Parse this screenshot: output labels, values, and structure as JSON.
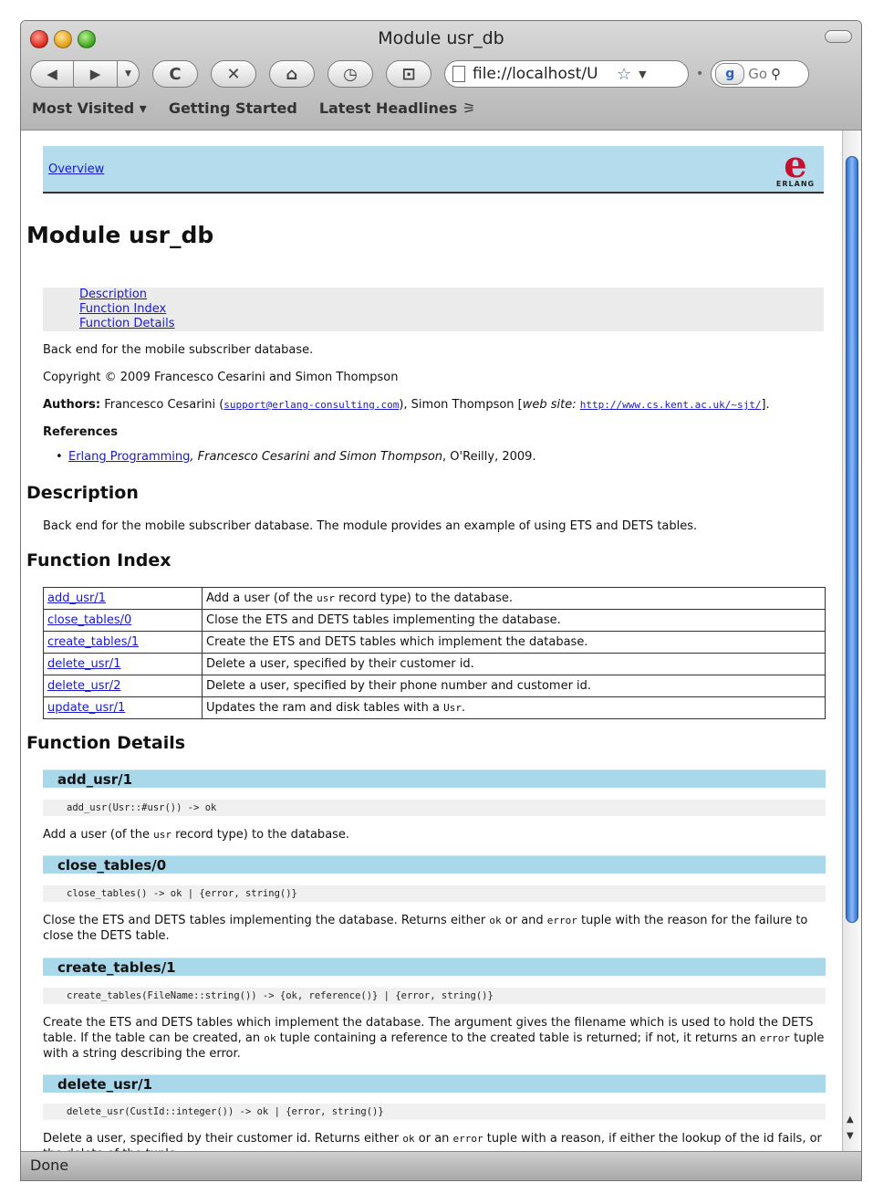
{
  "window": {
    "title": "Module usr_db"
  },
  "toolbar": {
    "back_icon": "back-arrow-icon",
    "forward_icon": "forward-arrow-icon",
    "history_dropdown": "▼",
    "reload": "C",
    "stop": "✕",
    "home": "⌂",
    "history": "◷",
    "bookmark": "⊡",
    "url": "file://localhost/U",
    "star": "☆",
    "url_dropdown": "▼",
    "search_engine": "g",
    "search_text": "Go",
    "search_icon": "magnifier-icon"
  },
  "bookmarks": [
    "Most Visited ▾",
    "Getting Started",
    "Latest Headlines ⚞"
  ],
  "page": {
    "overview_link": "Overview",
    "logo_text": "ERLANG",
    "module_title": "Module usr_db",
    "toc": [
      "Description",
      "Function Index",
      "Function Details"
    ],
    "summary": "Back end for the mobile subscriber database.",
    "copyright": "Copyright © 2009 Francesco Cesarini and Simon Thompson",
    "authors_label": "Authors:",
    "author1": "Francesco Cesarini (",
    "author1_email": "support@erlang-consulting.com",
    "author2": "), Simon Thompson [",
    "web_site_label": "web site:",
    "author2_url": "http://www.cs.kent.ac.uk/~sjt/",
    "authors_end": "].",
    "references_label": "References",
    "reference_link": "Erlang Programming",
    "reference_authors": ", Francesco Cesarini and Simon Thompson",
    "reference_pub": ", O'Reilly, 2009.",
    "description_heading": "Description",
    "description_text": "Back end for the mobile subscriber database. The module provides an example of using ETS and DETS tables.",
    "function_index_heading": "Function Index",
    "function_details_heading": "Function Details"
  },
  "function_index": [
    {
      "name": "add_usr/1",
      "desc_pre": "Add a user (of the ",
      "desc_code": "usr",
      "desc_post": " record type) to the database."
    },
    {
      "name": "close_tables/0",
      "desc_pre": "Close the ETS and DETS tables implementing the database.",
      "desc_code": "",
      "desc_post": ""
    },
    {
      "name": "create_tables/1",
      "desc_pre": "Create the ETS and DETS tables which implement the database.",
      "desc_code": "",
      "desc_post": ""
    },
    {
      "name": "delete_usr/1",
      "desc_pre": "Delete a user, specified by their customer id.",
      "desc_code": "",
      "desc_post": ""
    },
    {
      "name": "delete_usr/2",
      "desc_pre": "Delete a user, specified by their phone number and customer id.",
      "desc_code": "",
      "desc_post": ""
    },
    {
      "name": "update_usr/1",
      "desc_pre": "Updates the ram and disk tables with a ",
      "desc_code": "Usr",
      "desc_post": "."
    }
  ],
  "function_details": {
    "add_usr": {
      "heading": "add_usr/1",
      "spec": "add_usr(Usr::#usr()) -> ok",
      "d1": "Add a user (of the ",
      "c1": "usr",
      "d2": " record type) to the database."
    },
    "close_tables": {
      "heading": "close_tables/0",
      "spec": "close_tables() -> ok | {error, string()}",
      "d1": "Close the ETS and DETS tables implementing the database. Returns either ",
      "c1": "ok",
      "d2": " or and ",
      "c2": "error",
      "d3": " tuple with the reason for the failure to close the DETS table."
    },
    "create_tables": {
      "heading": "create_tables/1",
      "spec": "create_tables(FileName::string()) -> {ok, reference()} | {error, string()}",
      "d1": "Create the ETS and DETS tables which implement the database. The argument gives the filename which is used to hold the DETS table. If the table can be created, an ",
      "c1": "ok",
      "d2": " tuple containing a reference to the created table is returned; if not, it returns an ",
      "c2": "error",
      "d3": " tuple with a string describing the error."
    },
    "delete_usr": {
      "heading": "delete_usr/1",
      "spec": "delete_usr(CustId::integer()) -> ok | {error, string()}",
      "d1": "Delete a user, specified by their customer id. Returns either ",
      "c1": "ok",
      "d2": " or an ",
      "c2": "error",
      "d3": " tuple with a reason, if either the lookup of the id fails, or the delete of the tuple."
    }
  },
  "status": {
    "text": "Done"
  },
  "icons": {
    "close": "close-window-icon",
    "minimize": "minimize-window-icon",
    "zoom": "zoom-window-icon",
    "scroll_up": "▲",
    "scroll_down": "▼"
  }
}
